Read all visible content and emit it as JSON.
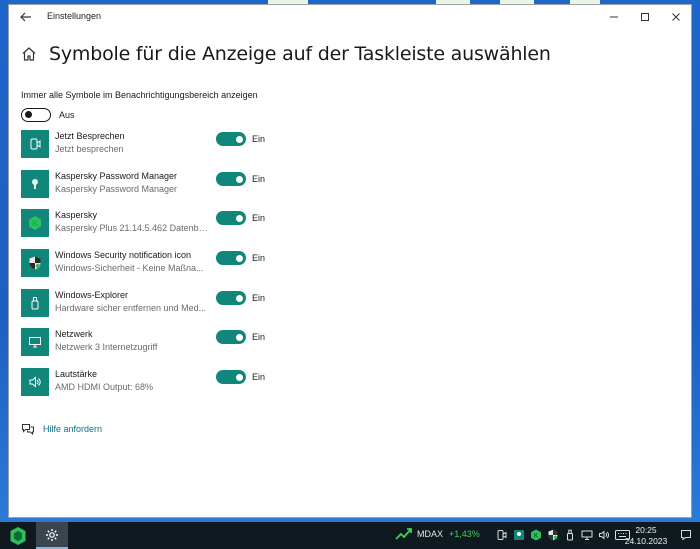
{
  "window": {
    "title": "Einstellungen",
    "controls": {
      "minimize": "—",
      "maximize": "☐",
      "close": "✕"
    }
  },
  "page": {
    "title": "Symbole für die Anzeige auf der Taskleiste auswählen"
  },
  "master": {
    "label": "Immer alle Symbole im Benachrichtigungsbereich anzeigen",
    "state": "Aus",
    "on": false
  },
  "items": [
    {
      "name": "Jetzt Besprechen",
      "sub": "Jetzt besprechen",
      "state": "Ein",
      "on": true,
      "icon": "meet-now-icon"
    },
    {
      "name": "Kaspersky Password Manager",
      "sub": "Kaspersky Password Manager",
      "state": "Ein",
      "on": true,
      "icon": "password-manager-icon"
    },
    {
      "name": "Kaspersky",
      "sub": "Kaspersky Plus 21.14.5.462 Datenba...",
      "state": "Ein",
      "on": true,
      "icon": "kaspersky-icon"
    },
    {
      "name": "Windows Security notification icon",
      "sub": "Windows-Sicherheit - Keine Maßna...",
      "state": "Ein",
      "on": true,
      "icon": "windows-security-icon"
    },
    {
      "name": "Windows-Explorer",
      "sub": "Hardware sicher entfernen und Med...",
      "state": "Ein",
      "on": true,
      "icon": "usb-drive-icon"
    },
    {
      "name": "Netzwerk",
      "sub": "Netzwerk 3 Internetzugriff",
      "state": "Ein",
      "on": true,
      "icon": "network-icon"
    },
    {
      "name": "Lautstärke",
      "sub": "AMD HDMI Output: 68%",
      "state": "Ein",
      "on": true,
      "icon": "volume-icon"
    }
  ],
  "help": {
    "label": "Hilfe anfordern"
  },
  "taskbar": {
    "stock": {
      "name": "MDAX",
      "change": "+1,43%"
    },
    "clock": {
      "time": "20:25",
      "date": "24.10.2023"
    }
  },
  "colors": {
    "accent": "#11867b",
    "link": "#0e6f84",
    "taskbar": "#0f1a20",
    "desktop": "#1e66c8"
  }
}
